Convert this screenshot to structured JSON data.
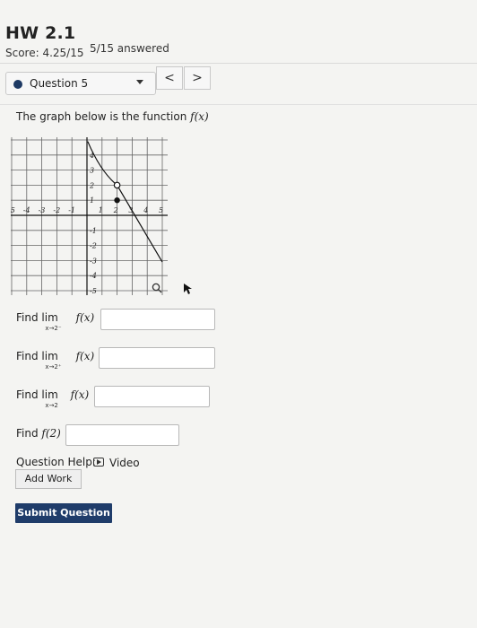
{
  "header": {
    "title": "HW 2.1",
    "score": "Score: 4.25/15",
    "answered": "5/15 answered"
  },
  "question_nav": {
    "selected": "Question 5",
    "prev_symbol": "<",
    "next_symbol": ">"
  },
  "problem": {
    "prompt_prefix": "The graph below is the function ",
    "function_name": "f(x)"
  },
  "graph": {
    "x_ticks": [
      "-5",
      "-4",
      "-3",
      "-2",
      "-1",
      "1",
      "2",
      "3",
      "4",
      "5"
    ],
    "y_ticks": [
      "4",
      "3",
      "2",
      "1",
      "-1",
      "-2",
      "-3",
      "-4",
      "-5"
    ],
    "open_point": [
      2,
      2
    ],
    "closed_point": [
      2,
      1
    ]
  },
  "questions": [
    {
      "find": "Find",
      "lim": "lim",
      "sub": "x→2⁻",
      "expr": "f(x)"
    },
    {
      "find": "Find",
      "lim": "lim",
      "sub": "x→2⁺",
      "expr": "f(x)"
    },
    {
      "find": "Find",
      "lim": "lim",
      "sub": "x→2",
      "expr": "f(x)"
    },
    {
      "find": "Find",
      "expr": "f(2)"
    }
  ],
  "help": {
    "label": "Question Help:",
    "video": "Video",
    "add_work": "Add Work"
  },
  "submit_label": "Submit Question"
}
